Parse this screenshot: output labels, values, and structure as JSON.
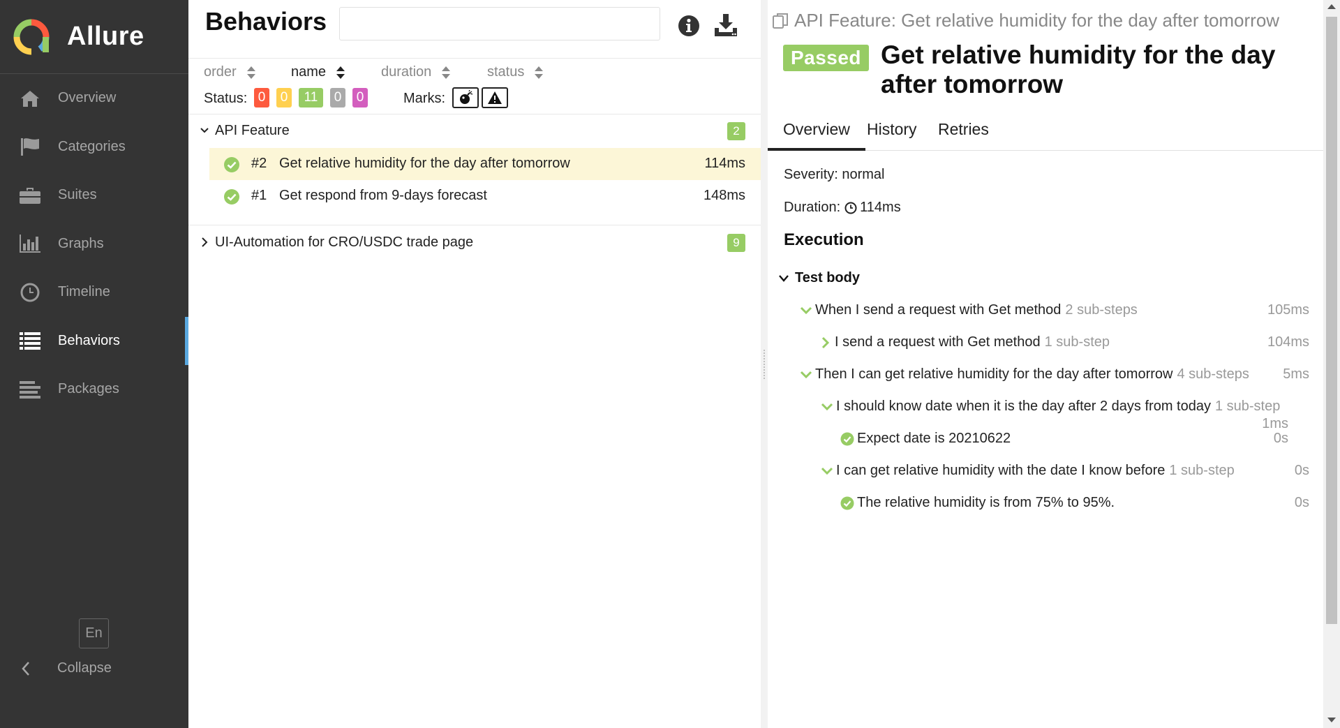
{
  "sidebar": {
    "brand": "Allure",
    "items": [
      {
        "label": "Overview",
        "icon": "home-icon"
      },
      {
        "label": "Categories",
        "icon": "flag-icon"
      },
      {
        "label": "Suites",
        "icon": "briefcase-icon"
      },
      {
        "label": "Graphs",
        "icon": "bar-chart-icon"
      },
      {
        "label": "Timeline",
        "icon": "clock-icon"
      },
      {
        "label": "Behaviors",
        "icon": "list-icon",
        "active": true
      },
      {
        "label": "Packages",
        "icon": "align-left-icon"
      }
    ],
    "language": "En",
    "collapse_label": "Collapse",
    "accent_color": "#5aa9e0"
  },
  "behaviors": {
    "title": "Behaviors",
    "search_value": "",
    "sort": {
      "order": "order",
      "name": "name",
      "duration": "duration",
      "status": "status"
    },
    "filters": {
      "status_label": "Status:",
      "statuses": [
        {
          "count": "0",
          "color": "#fd5a3e"
        },
        {
          "count": "0",
          "color": "#ffd050"
        },
        {
          "count": "11",
          "color": "#97cc64"
        },
        {
          "count": "0",
          "color": "#aaaaaa"
        },
        {
          "count": "0",
          "color": "#d35ebe"
        }
      ],
      "marks_label": "Marks:"
    },
    "groups": [
      {
        "name": "API Feature",
        "count": "2",
        "expanded": true,
        "tests": [
          {
            "num": "#2",
            "name": "Get relative humidity for the day after tomorrow",
            "duration": "114ms",
            "selected": true
          },
          {
            "num": "#1",
            "name": "Get respond from 9-days forecast",
            "duration": "148ms"
          }
        ]
      },
      {
        "name": "UI-Automation for CRO/USDC trade page",
        "count": "9",
        "expanded": false
      }
    ]
  },
  "detail": {
    "breadcrumb": "API Feature: Get relative humidity for the day after tomorrow",
    "status": "Passed",
    "status_color": "#97cc64",
    "title": "Get relative humidity for the day after tomorrow",
    "tabs": [
      "Overview",
      "History",
      "Retries"
    ],
    "severity": "Severity: normal",
    "duration_label": "Duration:",
    "duration_value": "114ms",
    "execution_title": "Execution",
    "test_body_label": "Test body",
    "steps": [
      {
        "text": "When I send a request with Get method",
        "sub": "2 sub-steps",
        "duration": "105ms"
      },
      {
        "text": "I send a request with Get method",
        "sub": "1 sub-step",
        "duration": "104ms"
      },
      {
        "text": "Then I can get relative humidity for the day after tomorrow",
        "sub": "4 sub-steps",
        "duration": "5ms"
      },
      {
        "text": "I should know date when it is the day after 2 days from today",
        "sub": "1 sub-step",
        "duration": "1ms"
      },
      {
        "text": "Expect date is 20210622",
        "duration": "0s"
      },
      {
        "text": "I can get relative humidity with the date I know before",
        "sub": "1 sub-step",
        "duration": "0s"
      },
      {
        "text": "The relative humidity is from 75% to 95%.",
        "duration": "0s"
      }
    ]
  }
}
